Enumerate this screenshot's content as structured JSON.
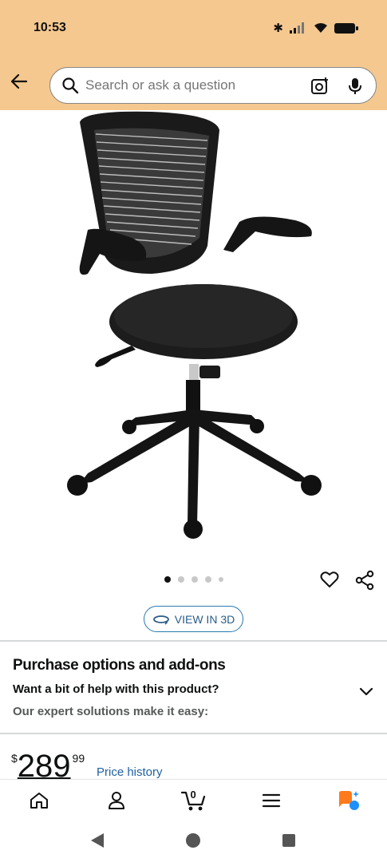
{
  "status_bar": {
    "time": "10:53"
  },
  "search": {
    "placeholder": "Search or ask a question"
  },
  "carousel": {
    "dot_count": 5,
    "active_index": 0
  },
  "view_3d": {
    "label": "VIEW IN 3D"
  },
  "purchase_options": {
    "title": "Purchase options and add-ons",
    "subtitle": "Want a bit of help with this product?",
    "description": "Our expert solutions make it easy:"
  },
  "price": {
    "currency": "$",
    "whole": "289",
    "fraction": "99",
    "history_link": "Price history"
  },
  "bottom_nav": {
    "items": [
      {
        "name": "home",
        "icon": "home-icon"
      },
      {
        "name": "account",
        "icon": "person-icon"
      },
      {
        "name": "cart",
        "icon": "cart-icon",
        "count": "0"
      },
      {
        "name": "menu",
        "icon": "hamburger-icon"
      },
      {
        "name": "rufus",
        "icon": "rufus-icon"
      }
    ]
  },
  "colors": {
    "header_bg": "#f5c88f",
    "link": "#2162a1",
    "view3d_border": "#2a7ab0",
    "rufus_orange": "#ff7a1a",
    "rufus_blue": "#1f8fff"
  }
}
